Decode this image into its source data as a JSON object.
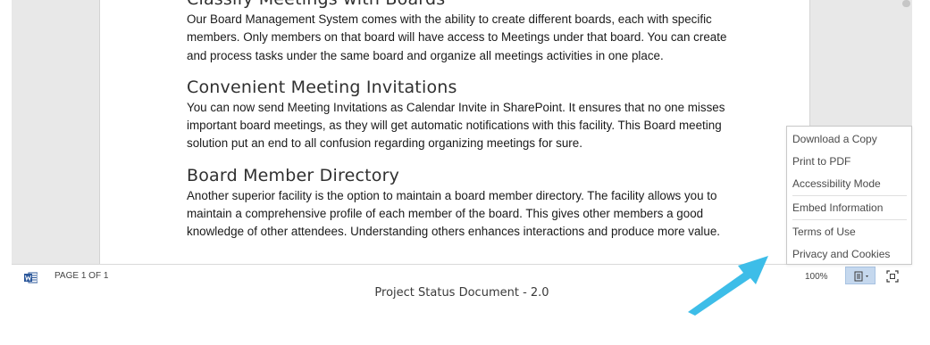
{
  "document": {
    "sections": [
      {
        "heading": "Classify Meetings with Boards",
        "body": "Our Board Management System comes with the ability to create different boards, each with specific members. Only members on that board will have access to Meetings under that board. You can create and process tasks under the same board and organize all meetings activities in one place."
      },
      {
        "heading": "Convenient Meeting Invitations",
        "body": "You can now send Meeting Invitations as Calendar Invite in SharePoint. It ensures that no one misses important board meetings, as they will get automatic notifications with this facility. This Board meeting solution put an end to all confusion regarding organizing meetings for sure."
      },
      {
        "heading": "Board Member Directory",
        "body": "Another superior facility is the option to maintain a board member directory. The facility allows you to maintain a comprehensive profile of each member of the board. This gives other members a good knowledge of other attendees. Understanding others enhances interactions and produce more value."
      }
    ]
  },
  "statusbar": {
    "app_icon": "word-icon",
    "page_count": "PAGE 1 OF 1",
    "zoom": "100%",
    "view_icon": "document-view-icon",
    "fullscreen_icon": "fullscreen-icon"
  },
  "menu": {
    "items": [
      "Download a Copy",
      "Print to PDF",
      "Accessibility Mode",
      "Embed Information",
      "Terms of Use",
      "Privacy and Cookies"
    ]
  },
  "caption": "Project Status Document - 2.0",
  "colors": {
    "arrow": "#3dbde8",
    "word_blue": "#2b579a",
    "view_button": "#c5d8ee"
  }
}
